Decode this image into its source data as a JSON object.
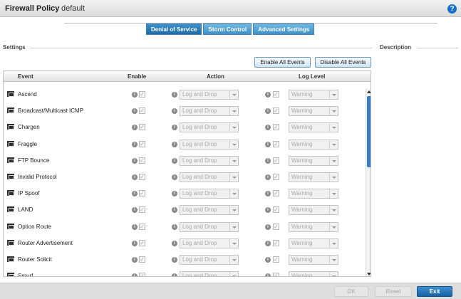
{
  "header": {
    "title": "Firewall Policy",
    "subtitle": "default",
    "help_icon": "question-mark-icon"
  },
  "tabs": [
    {
      "label": "Denial of Service",
      "active": true
    },
    {
      "label": "Storm Control",
      "active": false
    },
    {
      "label": "Advanced Settings",
      "active": false
    }
  ],
  "settings": {
    "title": "Settings"
  },
  "description": {
    "title": "Description"
  },
  "actions": {
    "enable_all": "Enable All Events",
    "disable_all": "Disable All Events"
  },
  "table": {
    "columns": {
      "event": "Event",
      "enable": "Enable",
      "action": "Action",
      "log_level": "Log Level"
    },
    "rows": [
      {
        "event": "Ascend",
        "enabled": true,
        "action": "Log and Drop",
        "log_level": "Warning"
      },
      {
        "event": "Broadcast/Multicast ICMP",
        "enabled": true,
        "action": "Log and Drop",
        "log_level": "Warning"
      },
      {
        "event": "Chargen",
        "enabled": true,
        "action": "Log and Drop",
        "log_level": "Warning"
      },
      {
        "event": "Fraggle",
        "enabled": true,
        "action": "Log and Drop",
        "log_level": "Warning"
      },
      {
        "event": "FTP Bounce",
        "enabled": true,
        "action": "Log and Drop",
        "log_level": "Warning"
      },
      {
        "event": "Invalid Protocol",
        "enabled": true,
        "action": "Log and Drop",
        "log_level": "Warning"
      },
      {
        "event": "IP Spoof",
        "enabled": true,
        "action": "Log and Drop",
        "log_level": "Warning"
      },
      {
        "event": "LAND",
        "enabled": true,
        "action": "Log and Drop",
        "log_level": "Warning"
      },
      {
        "event": "Option Route",
        "enabled": true,
        "action": "Log and Drop",
        "log_level": "Warning"
      },
      {
        "event": "Router Advertisement",
        "enabled": true,
        "action": "Log and Drop",
        "log_level": "Warning"
      },
      {
        "event": "Router Solicit",
        "enabled": true,
        "action": "Log and Drop",
        "log_level": "Warning"
      },
      {
        "event": "Smurf",
        "enabled": true,
        "action": "Log and Drop",
        "log_level": "Warning"
      }
    ]
  },
  "footer": {
    "ok": "OK",
    "reset": "Reset",
    "exit": "Exit"
  },
  "colors": {
    "accent": "#1d6ba6",
    "tab": "#3f90c6",
    "scroll_thumb": "#3a7cc2"
  }
}
